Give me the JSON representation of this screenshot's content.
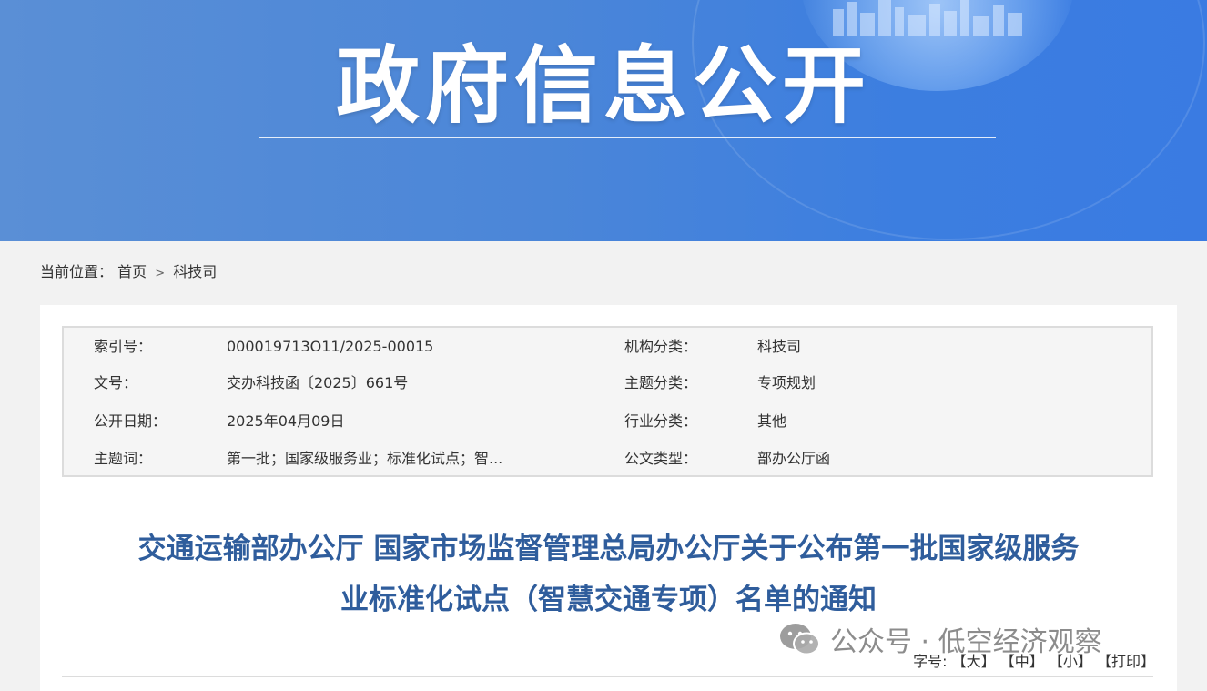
{
  "banner": {
    "title": "政府信息公开"
  },
  "breadcrumb": {
    "prefix": "当前位置：",
    "home": "首页",
    "separator": ">",
    "current": "科技司"
  },
  "meta": {
    "rows": [
      {
        "label_left": "索引号：",
        "value_left": "000019713O11/2025-00015",
        "label_right": "机构分类：",
        "value_right": "科技司"
      },
      {
        "label_left": "文号：",
        "value_left": "交办科技函〔2025〕661号",
        "label_right": "主题分类：",
        "value_right": "专项规划"
      },
      {
        "label_left": "公开日期：",
        "value_left": "2025年04月09日",
        "label_right": "行业分类：",
        "value_right": "其他"
      },
      {
        "label_left": "主题词：",
        "value_left": "第一批；国家级服务业；标准化试点；智...",
        "label_right": "公文类型：",
        "value_right": "部办公厅函"
      }
    ]
  },
  "document": {
    "title_line1": "交通运输部办公厅 国家市场监督管理总局办公厅关于公布第一批国家级服务",
    "title_line2": "业标准化试点（智慧交通专项）名单的通知"
  },
  "watermark": {
    "text": "公众号 · 低空经济观察",
    "icon": "wechat-icon"
  },
  "font_size": {
    "label": "字号:",
    "large": "【大】",
    "medium": "【中】",
    "small": "【小】",
    "print": "【打印】"
  },
  "colors": {
    "banner": "#4b86d8",
    "title": "#2f5d9c"
  }
}
